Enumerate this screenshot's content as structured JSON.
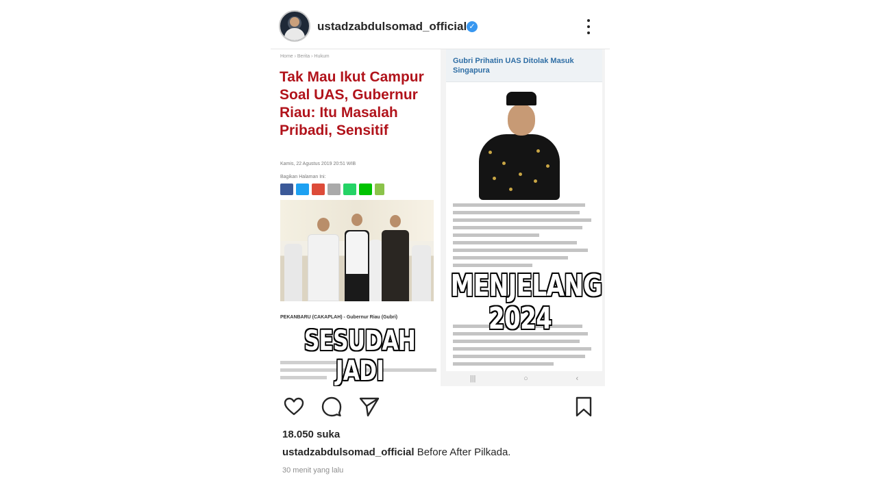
{
  "post": {
    "username": "ustadzabdulsomad_official",
    "verified_badge": "✓",
    "more_icon": "three-dots-vertical",
    "image": {
      "left_article": {
        "breadcrumb": "Home  ›  Berita  ›  Hukum",
        "headline": "Tak Mau Ikut Campur Soal UAS, Gubernur Riau: Itu Masalah Pribadi, Sensitif",
        "dateline": "Kamis, 22 Agustus 2019 20:51 WIB",
        "share_label": "Bagikan Halaman Ini:",
        "lede": "PEKANBARU (CAKAPLAH) - Gubernur Riau (Gubri)"
      },
      "right_article": {
        "title": "Gubri Prihatin UAS Ditolak Masuk Singapura"
      },
      "meme_left": "SESUDAH JADI\nGUBERNUR",
      "meme_right": "MENJELANG\n2024",
      "nav_buttons": [
        "|||",
        "○",
        "‹"
      ]
    },
    "actions": {
      "like_icon": "heart-icon",
      "comment_icon": "comment-icon",
      "share_icon": "send-icon",
      "save_icon": "bookmark-icon"
    },
    "likes": "18.050 suka",
    "caption_user": "ustadzabdulsomad_official",
    "caption_text": " Before After Pilkada.",
    "time": "30 menit yang lalu"
  }
}
